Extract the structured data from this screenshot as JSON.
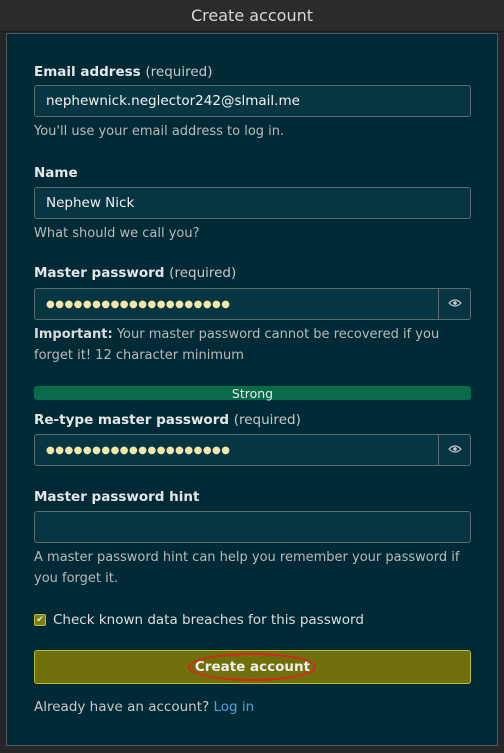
{
  "header": {
    "title": "Create account"
  },
  "email": {
    "label": "Email address",
    "required": "(required)",
    "value": "nephewnick.neglector242@slmail.me",
    "help": "You'll use your email address to log in."
  },
  "name": {
    "label": "Name",
    "value": "Nephew Nick",
    "help": "What should we call you?"
  },
  "master_password": {
    "label": "Master password",
    "required": "(required)",
    "masked": "●●●●●●●●●●●●●●●●●●●●",
    "help_strong": "Important:",
    "help_text": " Your master password cannot be recovered if you forget it! 12 character minimum"
  },
  "strength": {
    "label": "Strong",
    "color": "#0a6b4a"
  },
  "retype_password": {
    "label": "Re-type master password",
    "required": "(required)",
    "masked": "●●●●●●●●●●●●●●●●●●●●"
  },
  "hint": {
    "label": "Master password hint",
    "value": "",
    "help": "A master password hint can help you remember your password if you forget it."
  },
  "breach_check": {
    "label": "Check known data breaches for this password",
    "checked": true
  },
  "submit": {
    "label": "Create account"
  },
  "login": {
    "prompt": "Already have an account?",
    "link": "Log in"
  },
  "colors": {
    "panel": "#002b36",
    "button": "#6f700b",
    "link": "#4aa3df",
    "highlight_ring": "#e0201b"
  }
}
